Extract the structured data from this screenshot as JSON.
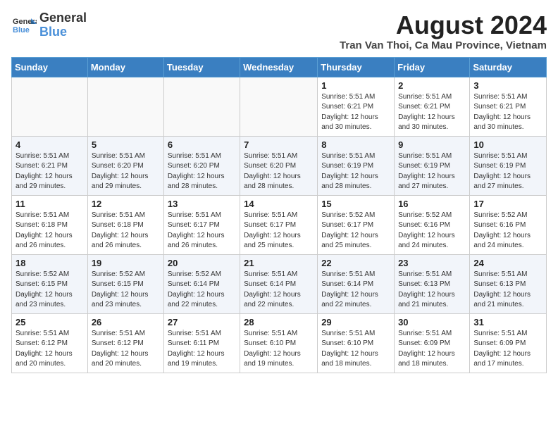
{
  "header": {
    "logo_line1": "General",
    "logo_line2": "Blue",
    "month_year": "August 2024",
    "location": "Tran Van Thoi, Ca Mau Province, Vietnam"
  },
  "weekdays": [
    "Sunday",
    "Monday",
    "Tuesday",
    "Wednesday",
    "Thursday",
    "Friday",
    "Saturday"
  ],
  "weeks": [
    [
      {
        "day": "",
        "info": ""
      },
      {
        "day": "",
        "info": ""
      },
      {
        "day": "",
        "info": ""
      },
      {
        "day": "",
        "info": ""
      },
      {
        "day": "1",
        "info": "Sunrise: 5:51 AM\nSunset: 6:21 PM\nDaylight: 12 hours\nand 30 minutes."
      },
      {
        "day": "2",
        "info": "Sunrise: 5:51 AM\nSunset: 6:21 PM\nDaylight: 12 hours\nand 30 minutes."
      },
      {
        "day": "3",
        "info": "Sunrise: 5:51 AM\nSunset: 6:21 PM\nDaylight: 12 hours\nand 30 minutes."
      }
    ],
    [
      {
        "day": "4",
        "info": "Sunrise: 5:51 AM\nSunset: 6:21 PM\nDaylight: 12 hours\nand 29 minutes."
      },
      {
        "day": "5",
        "info": "Sunrise: 5:51 AM\nSunset: 6:20 PM\nDaylight: 12 hours\nand 29 minutes."
      },
      {
        "day": "6",
        "info": "Sunrise: 5:51 AM\nSunset: 6:20 PM\nDaylight: 12 hours\nand 28 minutes."
      },
      {
        "day": "7",
        "info": "Sunrise: 5:51 AM\nSunset: 6:20 PM\nDaylight: 12 hours\nand 28 minutes."
      },
      {
        "day": "8",
        "info": "Sunrise: 5:51 AM\nSunset: 6:19 PM\nDaylight: 12 hours\nand 28 minutes."
      },
      {
        "day": "9",
        "info": "Sunrise: 5:51 AM\nSunset: 6:19 PM\nDaylight: 12 hours\nand 27 minutes."
      },
      {
        "day": "10",
        "info": "Sunrise: 5:51 AM\nSunset: 6:19 PM\nDaylight: 12 hours\nand 27 minutes."
      }
    ],
    [
      {
        "day": "11",
        "info": "Sunrise: 5:51 AM\nSunset: 6:18 PM\nDaylight: 12 hours\nand 26 minutes."
      },
      {
        "day": "12",
        "info": "Sunrise: 5:51 AM\nSunset: 6:18 PM\nDaylight: 12 hours\nand 26 minutes."
      },
      {
        "day": "13",
        "info": "Sunrise: 5:51 AM\nSunset: 6:17 PM\nDaylight: 12 hours\nand 26 minutes."
      },
      {
        "day": "14",
        "info": "Sunrise: 5:51 AM\nSunset: 6:17 PM\nDaylight: 12 hours\nand 25 minutes."
      },
      {
        "day": "15",
        "info": "Sunrise: 5:52 AM\nSunset: 6:17 PM\nDaylight: 12 hours\nand 25 minutes."
      },
      {
        "day": "16",
        "info": "Sunrise: 5:52 AM\nSunset: 6:16 PM\nDaylight: 12 hours\nand 24 minutes."
      },
      {
        "day": "17",
        "info": "Sunrise: 5:52 AM\nSunset: 6:16 PM\nDaylight: 12 hours\nand 24 minutes."
      }
    ],
    [
      {
        "day": "18",
        "info": "Sunrise: 5:52 AM\nSunset: 6:15 PM\nDaylight: 12 hours\nand 23 minutes."
      },
      {
        "day": "19",
        "info": "Sunrise: 5:52 AM\nSunset: 6:15 PM\nDaylight: 12 hours\nand 23 minutes."
      },
      {
        "day": "20",
        "info": "Sunrise: 5:52 AM\nSunset: 6:14 PM\nDaylight: 12 hours\nand 22 minutes."
      },
      {
        "day": "21",
        "info": "Sunrise: 5:51 AM\nSunset: 6:14 PM\nDaylight: 12 hours\nand 22 minutes."
      },
      {
        "day": "22",
        "info": "Sunrise: 5:51 AM\nSunset: 6:14 PM\nDaylight: 12 hours\nand 22 minutes."
      },
      {
        "day": "23",
        "info": "Sunrise: 5:51 AM\nSunset: 6:13 PM\nDaylight: 12 hours\nand 21 minutes."
      },
      {
        "day": "24",
        "info": "Sunrise: 5:51 AM\nSunset: 6:13 PM\nDaylight: 12 hours\nand 21 minutes."
      }
    ],
    [
      {
        "day": "25",
        "info": "Sunrise: 5:51 AM\nSunset: 6:12 PM\nDaylight: 12 hours\nand 20 minutes."
      },
      {
        "day": "26",
        "info": "Sunrise: 5:51 AM\nSunset: 6:12 PM\nDaylight: 12 hours\nand 20 minutes."
      },
      {
        "day": "27",
        "info": "Sunrise: 5:51 AM\nSunset: 6:11 PM\nDaylight: 12 hours\nand 19 minutes."
      },
      {
        "day": "28",
        "info": "Sunrise: 5:51 AM\nSunset: 6:10 PM\nDaylight: 12 hours\nand 19 minutes."
      },
      {
        "day": "29",
        "info": "Sunrise: 5:51 AM\nSunset: 6:10 PM\nDaylight: 12 hours\nand 18 minutes."
      },
      {
        "day": "30",
        "info": "Sunrise: 5:51 AM\nSunset: 6:09 PM\nDaylight: 12 hours\nand 18 minutes."
      },
      {
        "day": "31",
        "info": "Sunrise: 5:51 AM\nSunset: 6:09 PM\nDaylight: 12 hours\nand 17 minutes."
      }
    ]
  ]
}
